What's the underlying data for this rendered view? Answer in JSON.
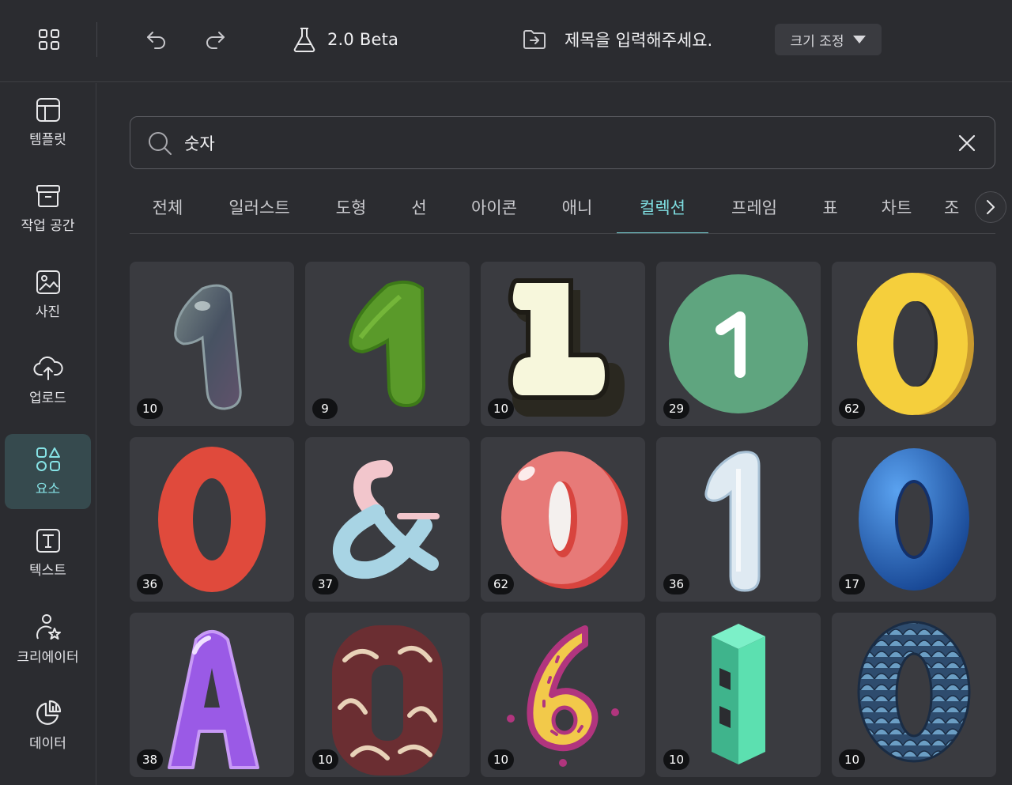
{
  "topbar": {
    "version_label": "2.0 Beta",
    "doc_title": "제목을 입력해주세요.",
    "resize_label": "크기 조정"
  },
  "sidebar": {
    "items": [
      {
        "label": "템플릿",
        "icon": "template-icon"
      },
      {
        "label": "작업 공간",
        "icon": "archive-box-icon"
      },
      {
        "label": "사진",
        "icon": "photo-icon"
      },
      {
        "label": "업로드",
        "icon": "cloud-upload-icon"
      },
      {
        "label": "요소",
        "icon": "shapes-icon",
        "active": true
      },
      {
        "label": "텍스트",
        "icon": "text-t-icon"
      },
      {
        "label": "크리에이터",
        "icon": "creator-star-icon"
      },
      {
        "label": "데이터",
        "icon": "pie-chart-icon"
      }
    ]
  },
  "search": {
    "value": "숫자"
  },
  "tabs": [
    "전체",
    "일러스트",
    "도형",
    "선",
    "아이콘",
    "애니",
    "컬렉션",
    "프레임",
    "표",
    "차트",
    "조"
  ],
  "active_tab": "컬렉션",
  "grid": {
    "tiles": [
      {
        "glyph": "1",
        "count": "10",
        "style": "bubble"
      },
      {
        "glyph": "1",
        "count": "9",
        "style": "grass"
      },
      {
        "glyph": "1",
        "count": "10",
        "style": "cream-outline"
      },
      {
        "glyph": "1",
        "count": "29",
        "style": "green-circle"
      },
      {
        "glyph": "0",
        "count": "62",
        "style": "yellow-3d"
      },
      {
        "glyph": "0",
        "count": "36",
        "style": "red-flat"
      },
      {
        "glyph": "&",
        "count": "37",
        "style": "pastel-ampersand"
      },
      {
        "glyph": "0",
        "count": "62",
        "style": "pink-glossy"
      },
      {
        "glyph": "1",
        "count": "36",
        "style": "ice"
      },
      {
        "glyph": "0",
        "count": "17",
        "style": "blue-glossy"
      },
      {
        "glyph": "A",
        "count": "38",
        "style": "purple-balloon"
      },
      {
        "glyph": "0",
        "count": "10",
        "style": "carved-wood"
      },
      {
        "glyph": "6",
        "count": "10",
        "style": "yellow-doodle"
      },
      {
        "glyph": "1",
        "count": "10",
        "style": "mint-isometric"
      },
      {
        "glyph": "0",
        "count": "10",
        "style": "dragon-scale"
      }
    ]
  },
  "colors": {
    "accent": "#7fe0e3",
    "background": "#2b2c30",
    "tile": "#3a3b40",
    "active_sidebar": "#364a4e"
  }
}
